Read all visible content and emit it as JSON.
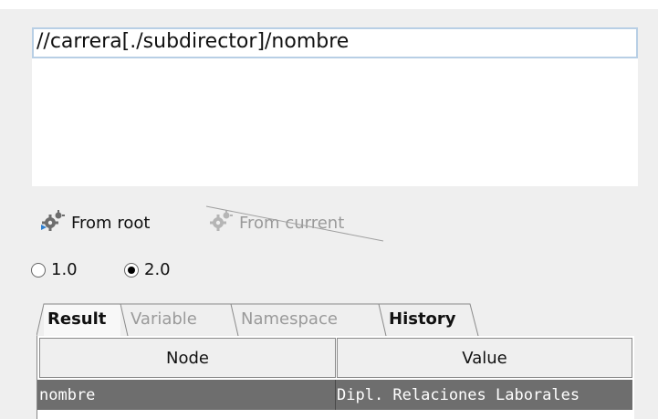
{
  "xpath": {
    "expression": "//carrera[./subdirector]/nombre"
  },
  "toolbar": {
    "from_root_label": "From root",
    "from_current_label": "From current"
  },
  "version": {
    "options": [
      {
        "label": "1.0",
        "selected": false
      },
      {
        "label": "2.0",
        "selected": true
      }
    ]
  },
  "tabs": [
    {
      "label": "Result",
      "active": true
    },
    {
      "label": "Variable",
      "active": false
    },
    {
      "label": "Namespace",
      "active": false
    },
    {
      "label": "History",
      "active": false
    }
  ],
  "results_table": {
    "columns": [
      "Node",
      "Value"
    ],
    "rows": [
      {
        "node": "nombre",
        "value": "Dipl. Relaciones Laborales",
        "selected": true
      }
    ]
  },
  "colors": {
    "selected_row": "#6e6e6e",
    "input_border": "#b8cfe5",
    "disabled_text": "#9a9a9a"
  }
}
